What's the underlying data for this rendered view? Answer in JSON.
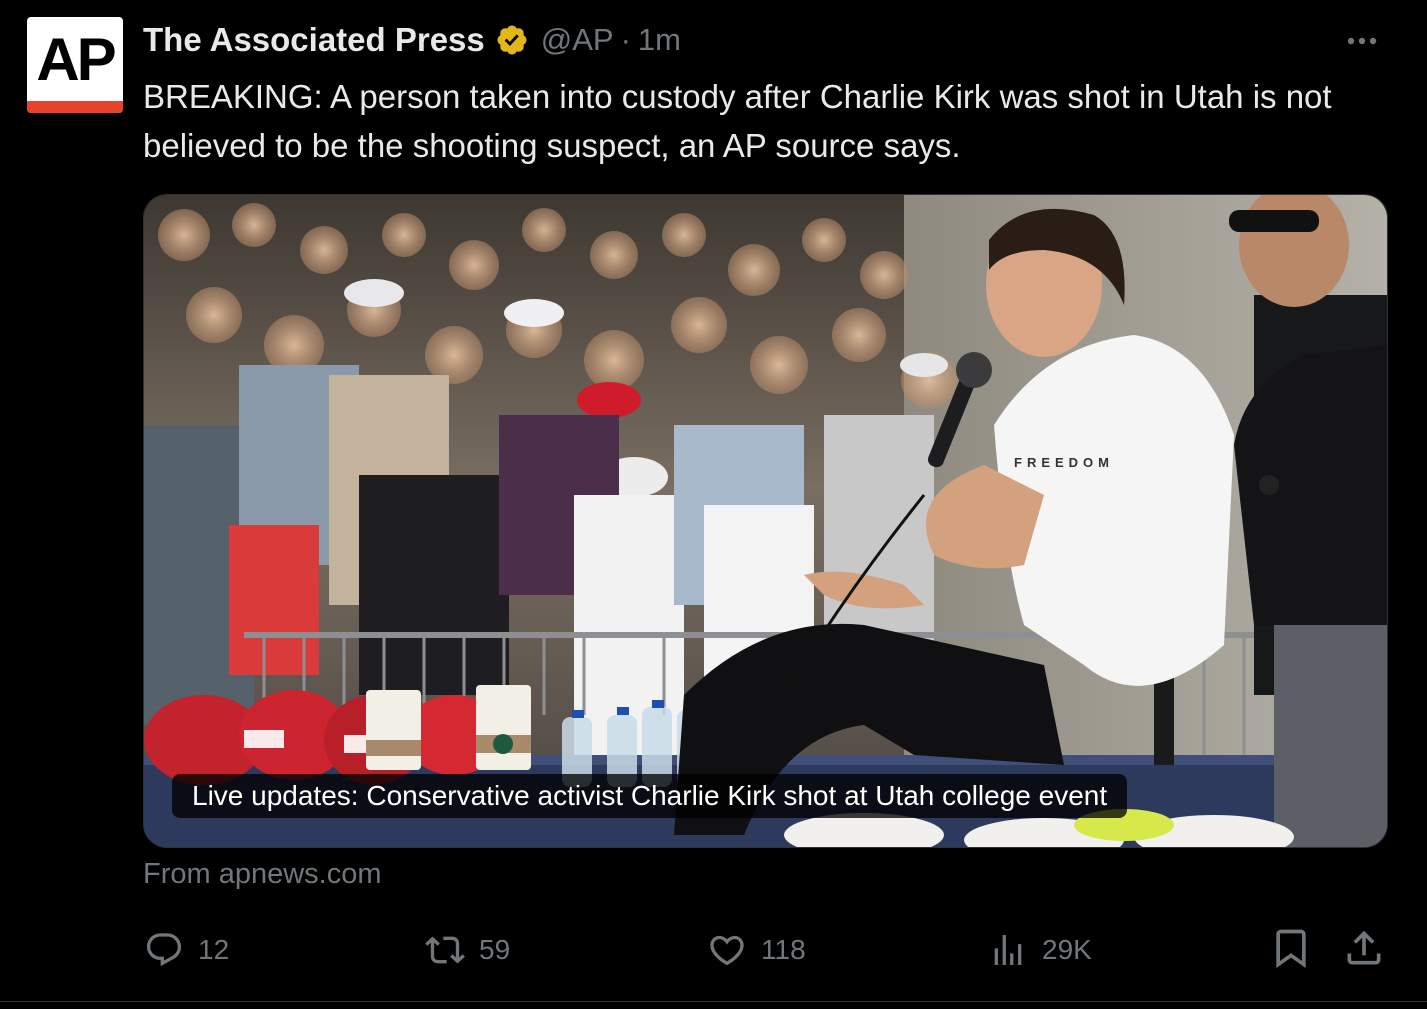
{
  "theme": {
    "background": "#000000",
    "text": "#e7e9ea",
    "muted": "#71767b",
    "verified_gold": "#e2b719",
    "ap_red": "#e8412c"
  },
  "author": {
    "avatar_text": "AP",
    "display_name": "The Associated Press",
    "verified": "verified-gold-badge-icon",
    "handle": "@AP",
    "separator": "·",
    "time": "1m"
  },
  "more_icon": "more-horizontal-icon",
  "tweet": {
    "text": "BREAKING: A person taken into custody after Charlie Kirk was shot in Utah is not believed to be the shooting suspect, an AP source says."
  },
  "card": {
    "photo": "photo of speaker in white shirt holding microphone in front of crowd",
    "caption": "Live updates: Conservative activist Charlie Kirk shot at Utah college event",
    "source": "From apnews.com"
  },
  "actions": {
    "reply": {
      "icon": "reply-icon",
      "count": "12"
    },
    "repost": {
      "icon": "repost-icon",
      "count": "59"
    },
    "like": {
      "icon": "heart-icon",
      "count": "118"
    },
    "views": {
      "icon": "views-icon",
      "count": "29K"
    },
    "bookmark": {
      "icon": "bookmark-icon"
    },
    "share": {
      "icon": "share-icon"
    }
  }
}
